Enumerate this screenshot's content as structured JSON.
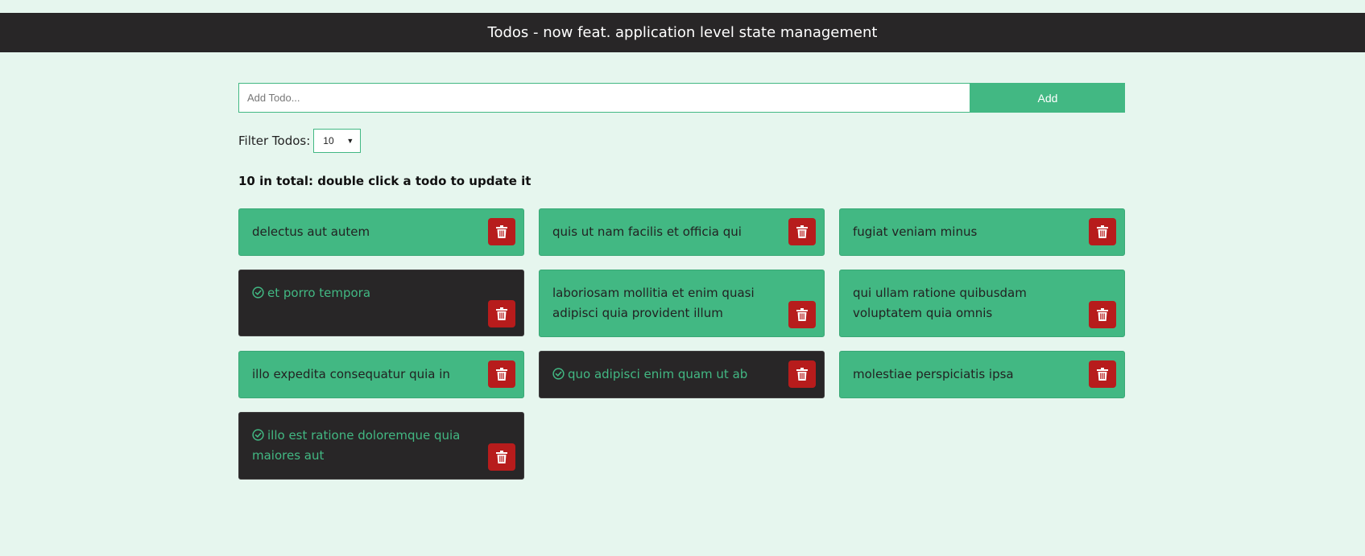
{
  "header": {
    "title": "Todos - now feat. application level state management"
  },
  "add_form": {
    "placeholder": "Add Todo...",
    "value": "",
    "button_label": "Add"
  },
  "filter": {
    "label": "Filter Todos:",
    "selected": "10"
  },
  "summary": {
    "text": "10 in total: double click a todo to update it"
  },
  "todos": [
    {
      "title": "delectus aut autem",
      "completed": false
    },
    {
      "title": "quis ut nam facilis et officia qui",
      "completed": false
    },
    {
      "title": "fugiat veniam minus",
      "completed": false
    },
    {
      "title": "et porro tempora",
      "completed": true
    },
    {
      "title": "laboriosam mollitia et enim quasi adipisci quia provident illum",
      "completed": false
    },
    {
      "title": "qui ullam ratione quibusdam voluptatem quia omnis",
      "completed": false
    },
    {
      "title": "illo expedita consequatur quia in",
      "completed": false
    },
    {
      "title": "quo adipisci enim quam ut ab",
      "completed": true
    },
    {
      "title": "molestiae perspiciatis ipsa",
      "completed": false
    },
    {
      "title": "illo est ratione doloremque quia maiores aut",
      "completed": true
    }
  ],
  "icons": {
    "completed": "check-circle-icon",
    "delete": "trash-icon"
  },
  "colors": {
    "accent": "#42b883",
    "header_bg": "#282627",
    "page_bg": "#e6f6ee",
    "completed_bg": "#282627",
    "delete_bg": "#b71c1c"
  }
}
